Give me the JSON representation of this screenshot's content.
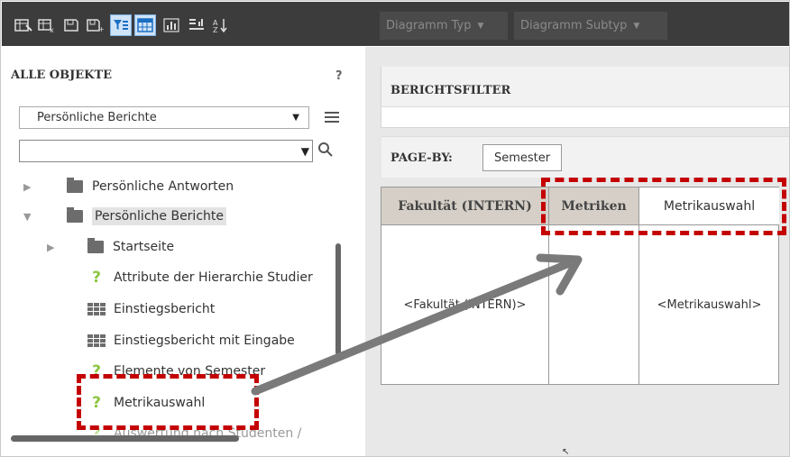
{
  "toolbar": {
    "chart_type_label": "Diagramm Typ",
    "chart_subtype_label": "Diagramm Subtyp"
  },
  "left_panel": {
    "title": "ALLE OBJEKTE",
    "help": "?",
    "folder_select": "Persönliche Berichte",
    "search_value": "",
    "items": [
      {
        "label": "Persönliche Antworten",
        "type": "folder",
        "expanded": false
      },
      {
        "label": "Persönliche Berichte",
        "type": "folder",
        "expanded": true
      },
      {
        "label": "Startseite",
        "type": "folder",
        "expanded": false
      },
      {
        "label": "Attribute der Hierarchie Studier",
        "type": "prompt"
      },
      {
        "label": "Einstiegsbericht",
        "type": "report"
      },
      {
        "label": "Einstiegsbericht mit Eingabe",
        "type": "report"
      },
      {
        "label": "Elemente von Semester",
        "type": "prompt"
      },
      {
        "label": "Metrikauswahl",
        "type": "prompt"
      },
      {
        "label": "Auswertung nach Studenten /",
        "type": "prompt"
      }
    ]
  },
  "right_panel": {
    "report_filter_title": "BERICHTSFILTER",
    "page_by_label": "PAGE-BY:",
    "page_by_value": "Semester",
    "grid": {
      "headers": [
        "Fakultät (INTERN)",
        "Metriken",
        "Metrikauswahl"
      ],
      "cells": [
        "<Fakultät (INTERN)>",
        "",
        "<Metrikauswahl>"
      ]
    }
  },
  "colors": {
    "highlight": "#c40000",
    "toolbar_bg": "#3c3c3c",
    "prompt_icon": "#8cc63f"
  }
}
